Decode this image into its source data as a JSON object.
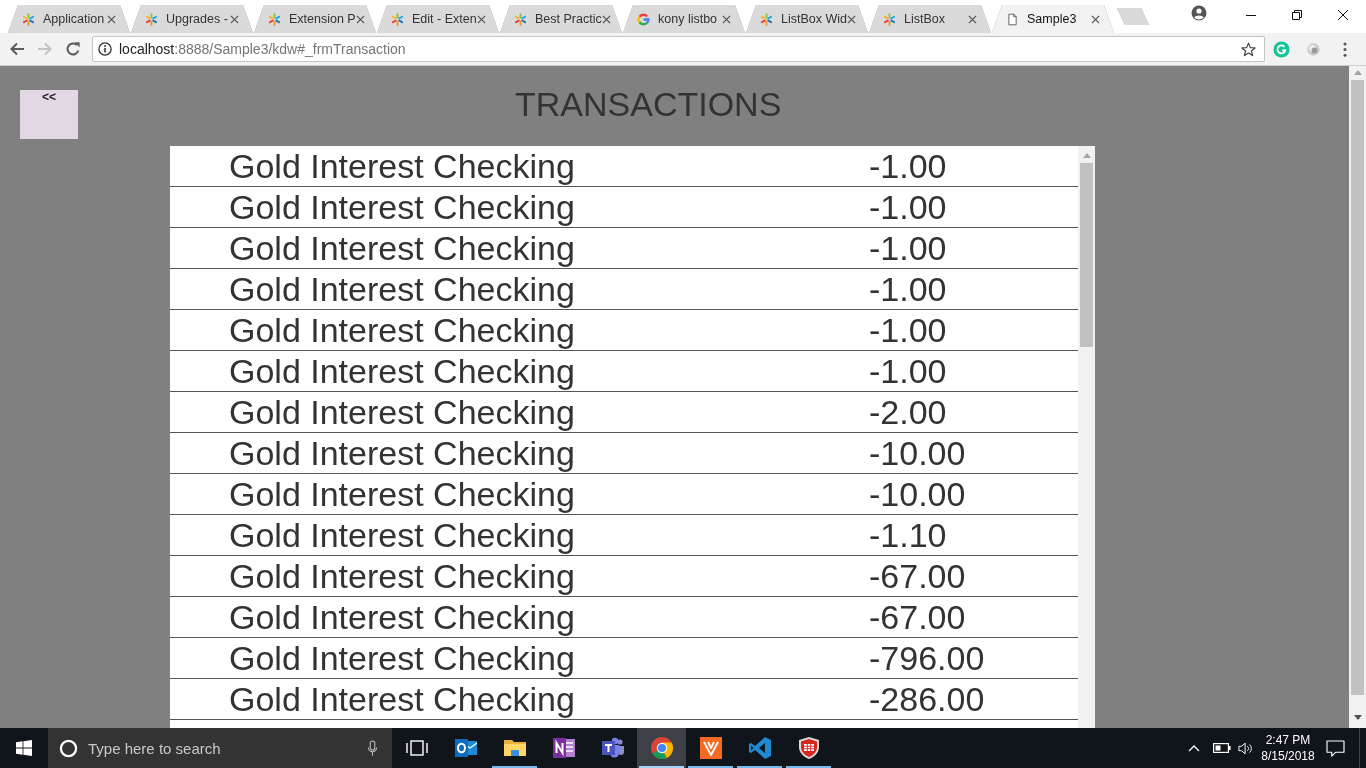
{
  "browser": {
    "tabs": [
      {
        "kind": "pinwheel",
        "title": "Application",
        "selected": false
      },
      {
        "kind": "pinwheel",
        "title": "Upgrades -",
        "selected": false
      },
      {
        "kind": "pinwheel",
        "title": "Extension P",
        "selected": false
      },
      {
        "kind": "pinwheel",
        "title": "Edit - Exten",
        "selected": false
      },
      {
        "kind": "pinwheel",
        "title": "Best Practic",
        "selected": false
      },
      {
        "kind": "google",
        "title": "kony listbo",
        "selected": false
      },
      {
        "kind": "pinwheel",
        "title": "ListBox Wid",
        "selected": false
      },
      {
        "kind": "pinwheel",
        "title": "ListBox",
        "selected": false
      },
      {
        "kind": "page",
        "title": "Sample3",
        "selected": true
      }
    ],
    "toolbar": {
      "nav": [
        {
          "kind": "back",
          "disabled": false
        },
        {
          "kind": "forward",
          "disabled": true
        },
        {
          "kind": "reload",
          "disabled": false
        }
      ],
      "address": {
        "host": "localhost",
        "path": ":8888/Sample3/kdw#_frmTransaction"
      }
    }
  },
  "page": {
    "back_button": "<<",
    "title": "TRANSACTIONS",
    "transactions": [
      {
        "description": "Gold Interest Checking",
        "amount": "-1.00"
      },
      {
        "description": "Gold Interest Checking",
        "amount": "-1.00"
      },
      {
        "description": "Gold Interest Checking",
        "amount": "-1.00"
      },
      {
        "description": "Gold Interest Checking",
        "amount": "-1.00"
      },
      {
        "description": "Gold Interest Checking",
        "amount": "-1.00"
      },
      {
        "description": "Gold Interest Checking",
        "amount": "-1.00"
      },
      {
        "description": "Gold Interest Checking",
        "amount": "-2.00"
      },
      {
        "description": "Gold Interest Checking",
        "amount": "-10.00"
      },
      {
        "description": "Gold Interest Checking",
        "amount": "-10.00"
      },
      {
        "description": "Gold Interest Checking",
        "amount": "-1.10"
      },
      {
        "description": "Gold Interest Checking",
        "amount": "-67.00"
      },
      {
        "description": "Gold Interest Checking",
        "amount": "-67.00"
      },
      {
        "description": "Gold Interest Checking",
        "amount": "-796.00"
      },
      {
        "description": "Gold Interest Checking",
        "amount": "-286.00"
      }
    ]
  },
  "taskbar": {
    "search": {
      "placeholder": "Type here to search"
    },
    "apps": [
      {
        "kind": "mail",
        "running": false,
        "selected": false
      },
      {
        "kind": "folder",
        "running": true,
        "selected": false
      },
      {
        "kind": "notebook",
        "running": false,
        "selected": false
      },
      {
        "kind": "team",
        "running": false,
        "selected": false
      },
      {
        "kind": "browser",
        "running": true,
        "selected": true
      },
      {
        "kind": "chevron",
        "running": true,
        "selected": false
      },
      {
        "kind": "code",
        "running": true,
        "selected": false
      },
      {
        "kind": "shield",
        "running": true,
        "selected": false
      }
    ],
    "clock": {
      "time": "2:47 PM",
      "date": "8/15/2018"
    }
  }
}
